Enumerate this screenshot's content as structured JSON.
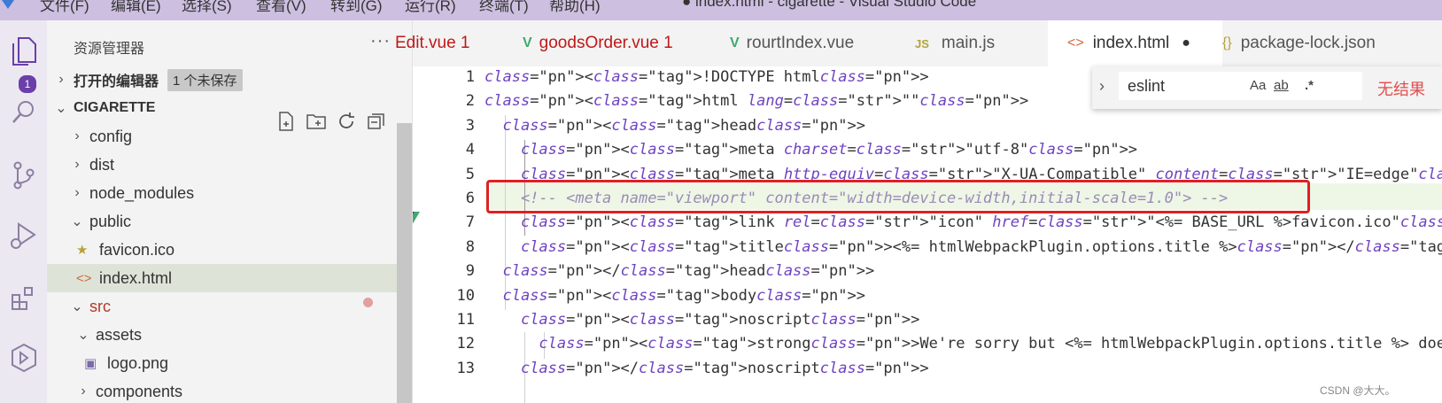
{
  "colors": {
    "accent": "#6a3fa8",
    "error_text": "#c01818",
    "vue_green": "#42a870",
    "highlight_box": "#e02020"
  },
  "titlebar": {
    "menus": [
      "文件(F)",
      "编辑(E)",
      "选择(S)",
      "查看(V)",
      "转到(G)",
      "运行(R)",
      "终端(T)",
      "帮助(H)"
    ],
    "window_title": "● index.html - cigarette - Visual Studio Code"
  },
  "activity": {
    "badge": "1",
    "icons": [
      "explorer-icon",
      "search-icon",
      "source-control-icon",
      "run-debug-icon",
      "extensions-icon",
      "remote-icon"
    ]
  },
  "sidebar": {
    "title": "资源管理器",
    "more": "···",
    "open_editors": "打开的编辑器",
    "unsaved": "1 个未保存",
    "project": "CIGARETTE",
    "tree": [
      {
        "label": "config",
        "chevron": "›",
        "indent": 1
      },
      {
        "label": "dist",
        "chevron": "›",
        "indent": 1
      },
      {
        "label": "node_modules",
        "chevron": "›",
        "indent": 1
      },
      {
        "label": "public",
        "chevron": "⌄",
        "indent": 1
      },
      {
        "label": "favicon.ico",
        "icon": "★",
        "indent": 2
      },
      {
        "label": "index.html",
        "icon": "<>",
        "indent": 2,
        "selected": true
      },
      {
        "label": "src",
        "chevron": "⌄",
        "indent": 1,
        "modified": true
      },
      {
        "label": "assets",
        "chevron": "⌄",
        "indent": 2
      },
      {
        "label": "logo.png",
        "icon": "▣",
        "indent": 3
      },
      {
        "label": "components",
        "chevron": "›",
        "indent": 2
      }
    ]
  },
  "tabs": [
    {
      "label": "Edit.vue 1",
      "icon": "",
      "error": true
    },
    {
      "label": "goodsOrder.vue 1",
      "icon": "V",
      "error": true
    },
    {
      "label": "rourtIndex.vue",
      "icon": "V",
      "error": false
    },
    {
      "label": "main.js",
      "icon": "JS",
      "error": false
    },
    {
      "label": "index.html",
      "icon": "<>",
      "error": false,
      "active": true,
      "dirty": "●"
    },
    {
      "label": "package-lock.json",
      "icon": "{}",
      "error": false
    }
  ],
  "find": {
    "value": "eslint",
    "options": [
      "Aa",
      "ab",
      ".*"
    ],
    "result": "无结果"
  },
  "editor": {
    "line_numbers": [
      "1",
      "2",
      "3",
      "4",
      "5",
      "6",
      "7",
      "8",
      "9",
      "10",
      "11",
      "12",
      "13"
    ],
    "lines": [
      "<!DOCTYPE html>",
      "<html lang=\"\">",
      "  <head>",
      "    <meta charset=\"utf-8\">",
      "    <meta http-equiv=\"X-UA-Compatible\" content=\"IE=edge\">",
      "    <!-- <meta name=\"viewport\" content=\"width=device-width,initial-scale=1.0\"> -->",
      "    <link rel=\"icon\" href=\"<%= BASE_URL %>favicon.ico\">",
      "    <title><%= htmlWebpackPlugin.options.title %></title>",
      "  </head>",
      "  <body>",
      "    <noscript>",
      "      <strong>We're sorry but <%= htmlWebpackPlugin.options.title %> doesn't work properly w",
      "    </noscript>"
    ]
  },
  "watermark": "CSDN @大大。"
}
